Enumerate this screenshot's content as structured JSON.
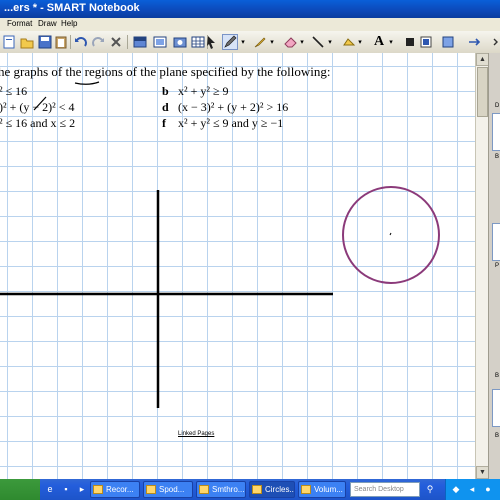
{
  "window": {
    "title": "...ers * - SMART Notebook"
  },
  "menu": {
    "items": [
      "Format",
      "Draw",
      "Help"
    ]
  },
  "toolbar": {
    "buttons": [
      "new-page-icon",
      "open-icon",
      "save-icon",
      "paste-icon",
      "undo-icon",
      "redo-icon",
      "delete-icon",
      "screen-shade-icon",
      "full-screen-icon",
      "capture-icon",
      "table-icon",
      "select-icon",
      "pen-icon",
      "creative-pen-icon",
      "eraser-icon",
      "line-icon",
      "shape-icon",
      "text-icon",
      "fill-icon",
      "properties-icon",
      "move-toolbar-icon"
    ],
    "text_tool_glyph": "A"
  },
  "page": {
    "intro": "he graphs of the regions of the plane specified by the following:",
    "items": [
      {
        "letter": "",
        "text": "² ≤ 16"
      },
      {
        "letter": "b",
        "text": "x² + y² ≥ 9"
      },
      {
        "letter": "",
        "text": ")² + (y − 2)² < 4"
      },
      {
        "letter": "d",
        "text": "(x − 3)² + (y + 2)² > 16"
      },
      {
        "letter": "",
        "text": "² ≤ 16 and x ≤ 2"
      },
      {
        "letter": "f",
        "text": "x² + y² ≤ 9 and y ≥ −1"
      }
    ],
    "linked_pages": "Linked Pages",
    "ink_color": "#000000",
    "circle_color": "#8B3A7A"
  },
  "sidebar": {
    "labels": [
      "D",
      "B",
      "P",
      "B",
      "B"
    ]
  },
  "taskbar": {
    "tasks": [
      "Recor...",
      "Spod...",
      "Smthro...",
      "Circles...",
      "Volum...",
      "..."
    ],
    "search_placeholder": "Search Desktop"
  },
  "colors": {
    "titlebar": "#0C48B8",
    "grid": "#B9D3EE",
    "taskbar": "#245EDC"
  }
}
